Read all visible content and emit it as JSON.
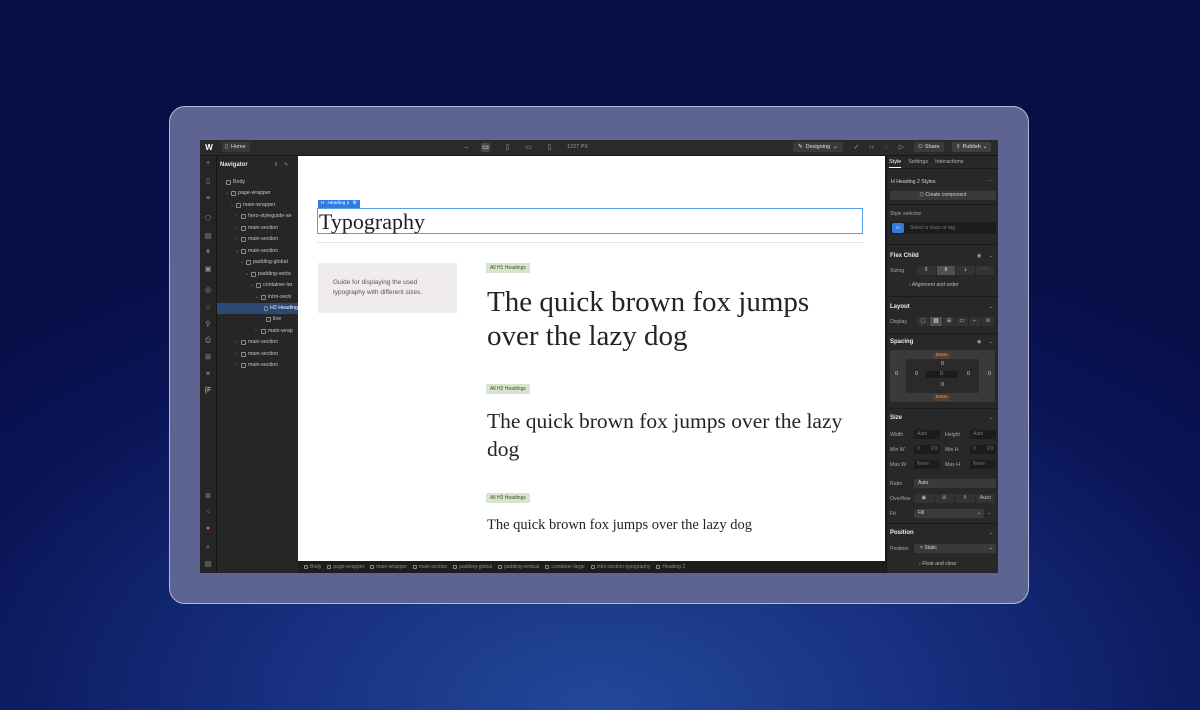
{
  "topbar": {
    "page_name": "Home",
    "breakpoint_size": "1227 PX",
    "mode_label": "Designing",
    "share_label": "Share",
    "publish_label": "Publish"
  },
  "navigator": {
    "title": "Navigator",
    "items": [
      {
        "label": "Body",
        "depth": 0
      },
      {
        "label": "page-wrapper",
        "depth": 1
      },
      {
        "label": "main-wrapper",
        "depth": 2
      },
      {
        "label": "hero-styleguide-se",
        "depth": 3
      },
      {
        "label": "main-section",
        "depth": 3
      },
      {
        "label": "main-section",
        "depth": 3
      },
      {
        "label": "main-section",
        "depth": 3
      },
      {
        "label": "padding-global",
        "depth": 4
      },
      {
        "label": "padding-vertic",
        "depth": 5
      },
      {
        "label": "container-lar",
        "depth": 6
      },
      {
        "label": "intro-secti",
        "depth": 7
      },
      {
        "label": "H2 Heading",
        "depth": 8
      },
      {
        "label": "line",
        "depth": 8
      },
      {
        "label": "main-wrap",
        "depth": 7
      },
      {
        "label": "main-section",
        "depth": 3
      },
      {
        "label": "main-section",
        "depth": 3
      },
      {
        "label": "main-section",
        "depth": 3
      }
    ]
  },
  "canvas": {
    "selection_badge": "Heading 2",
    "heading": "Typography",
    "guide_text": "Guide for displaying the used typography with different sizes.",
    "samples": [
      {
        "tag": "All H1 Headings",
        "text": "The quick brown fox jumps over the lazy dog"
      },
      {
        "tag": "All H2 Headings",
        "text": "The quick brown fox jumps over the lazy dog"
      },
      {
        "tag": "All H3 Headings",
        "text": "The quick brown fox jumps over the lazy dog"
      }
    ]
  },
  "breadcrumbs": [
    "Body",
    "page-wrapper",
    "main-wrapper",
    "main-section",
    "padding-global",
    "padding-vertical",
    "container-large",
    "intro-section-typography",
    "Heading 2"
  ],
  "panel": {
    "tabs": [
      "Style",
      "Settings",
      "Interactions"
    ],
    "styles_title": "Heading 2 Styles",
    "create_component": "Create component",
    "style_selector_label": "Style selector",
    "class_placeholder": "Select a class or tag",
    "flex_child": "Flex Child",
    "sizing_label": "Sizing",
    "alignment_order": "Alignment and order",
    "layout": "Layout",
    "display_label": "Display",
    "spacing": "Spacing",
    "margin_unit": "Dmm",
    "spacing_values": {
      "margin_left": "0",
      "padding_left": "0",
      "padding_top": "0",
      "padding_center": "0",
      "padding_bottom": "0",
      "padding_right": "0",
      "margin_right": "0"
    },
    "size": "Size",
    "width_label": "Width",
    "width_val": "Auto",
    "height_label": "Height",
    "height_val": "Auto",
    "min_w_label": "Min W",
    "min_w_val": "0",
    "min_w_unit": "PX",
    "min_h_label": "Min H",
    "min_h_val": "0",
    "min_h_unit": "PX",
    "max_w_label": "Max W",
    "max_w_val": "None",
    "max_h_label": "Max H",
    "max_h_val": "None",
    "ratio_label": "Ratio",
    "ratio_val": "Auto",
    "overflow_label": "Overflow",
    "overflow_auto": "Auto",
    "fit_label": "Fit",
    "fit_val": "Fill",
    "position": "Position",
    "position_label": "Position",
    "position_val": "Static",
    "float_clear": "Float and clear"
  }
}
